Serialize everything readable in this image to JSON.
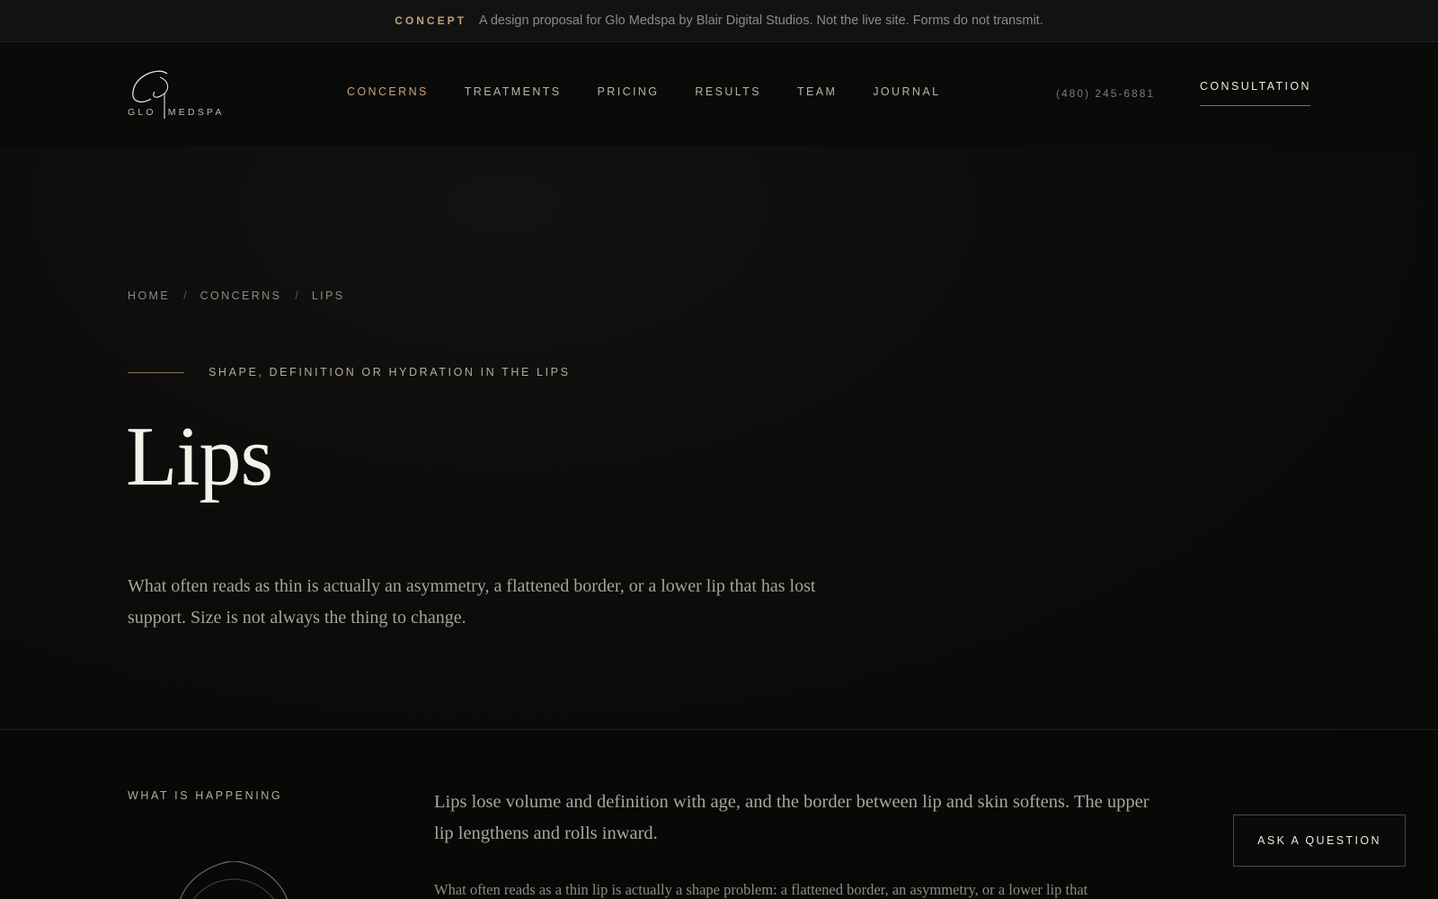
{
  "banner": {
    "tag": "CONCEPT",
    "text": "A design proposal for Glo Medspa by Blair Digital Studios. Not the live site. Forms do not transmit."
  },
  "brand": {
    "logo_word_left": "GLO",
    "logo_word_right": "MEDSPA"
  },
  "nav": {
    "items": [
      {
        "label": "CONCERNS",
        "active": true
      },
      {
        "label": "TREATMENTS",
        "active": false
      },
      {
        "label": "PRICING",
        "active": false
      },
      {
        "label": "RESULTS",
        "active": false
      },
      {
        "label": "TEAM",
        "active": false
      },
      {
        "label": "JOURNAL",
        "active": false
      }
    ],
    "phone": "(480) 245-6881",
    "cta": "CONSULTATION"
  },
  "breadcrumb": {
    "items": [
      "HOME",
      "CONCERNS",
      "LIPS"
    ],
    "separator": "/"
  },
  "hero": {
    "eyebrow": "SHAPE, DEFINITION OR HYDRATION IN THE LIPS",
    "title": "Lips",
    "lede": "What often reads as thin is actually an asymmetry, a flattened border, or a lower lip that has lost support. Size is not always the thing to change."
  },
  "section": {
    "label": "WHAT IS HAPPENING",
    "lede": "Lips lose volume and definition with age, and the border between lip and skin softens. The upper lip lengthens and rolls inward.",
    "body": "What often reads as a thin lip is actually a shape problem: a flattened border, an asymmetry, or a lower lip that"
  },
  "floating": {
    "ask_label": "ASK A QUESTION"
  },
  "colors": {
    "accent": "#c9a27c",
    "background": "#080807",
    "text_primary": "#f4f1ea"
  }
}
